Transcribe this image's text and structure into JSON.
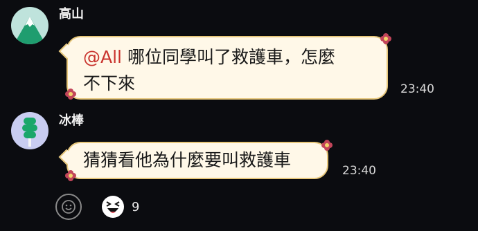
{
  "colors": {
    "background": "#0b0c10",
    "bubble": "#fff8e8",
    "bubble_border": "#e7c77b",
    "mention": "#c9342e"
  },
  "messages": [
    {
      "sender": "高山",
      "avatar_icon": "mountain-avatar-icon",
      "mention": "@All",
      "text_line1": " 哪位同學叫了救護車，怎麼",
      "text_line2": "不下來",
      "time": "23:40"
    },
    {
      "sender": "冰棒",
      "avatar_icon": "popsicle-avatar-icon",
      "text": "猜猜看他為什麼要叫救護車",
      "time": "23:40"
    }
  ],
  "reactions": {
    "add_icon": "smiley-add-icon",
    "items": [
      {
        "emoji_icon": "laughing-face-icon",
        "count": "9"
      }
    ]
  }
}
